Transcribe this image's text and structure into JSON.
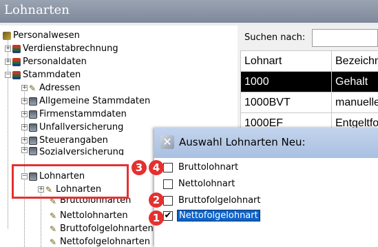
{
  "window": {
    "title": "Lohnarten"
  },
  "tree": {
    "items": [
      {
        "label": "Personalwesen",
        "icon": "root-icon"
      },
      {
        "label": "Verdienstabrechnung",
        "icon": "database-icon"
      },
      {
        "label": "Personaldaten",
        "icon": "database-icon"
      },
      {
        "label": "Stammdaten",
        "icon": "database-icon"
      },
      {
        "label": "Adressen",
        "icon": "leaf-icon"
      },
      {
        "label": "Allgemeine Stammdaten",
        "icon": "book-icon"
      },
      {
        "label": "Firmenstammdaten",
        "icon": "book-icon"
      },
      {
        "label": "Unfallversicherung",
        "icon": "book-icon"
      },
      {
        "label": "Steuerangaben",
        "icon": "book-icon"
      },
      {
        "label": "Sozialversicherung",
        "icon": "book-icon"
      },
      {
        "label": "Lohnarten",
        "icon": "book-icon"
      },
      {
        "label": "Lohnarten",
        "icon": "leaf-icon"
      },
      {
        "label": "Bruttolohnarten",
        "icon": "leaf-icon"
      },
      {
        "label": "Nettolohnarten",
        "icon": "leaf-icon"
      },
      {
        "label": "Bruttofolgelohnarten",
        "icon": "leaf-icon"
      },
      {
        "label": "Nettofolgelohnarten",
        "icon": "leaf-icon"
      }
    ]
  },
  "search": {
    "label": "Suchen nach:",
    "value": ""
  },
  "grid": {
    "headers": [
      "Lohnart",
      "Bezeichn"
    ],
    "rows": [
      [
        "1000",
        "Gehalt"
      ],
      [
        "1000BVT",
        "manuelle"
      ],
      [
        "1000EF",
        "Entgeltfo"
      ]
    ]
  },
  "dialog": {
    "title": "Auswahl Lohnarten Neu:",
    "options": [
      {
        "label": "Bruttolohnart",
        "checked": false
      },
      {
        "label": "Nettolohnart",
        "checked": false
      },
      {
        "label": "Bruttofolgelohnart",
        "checked": false
      },
      {
        "label": "Nettofolgelohnart",
        "checked": true
      }
    ]
  },
  "callouts": [
    "3",
    "4",
    "2",
    "1"
  ],
  "colors": {
    "callout": "#e53030",
    "selection": "#0d63c9",
    "titlebar": "#8a93a3"
  }
}
